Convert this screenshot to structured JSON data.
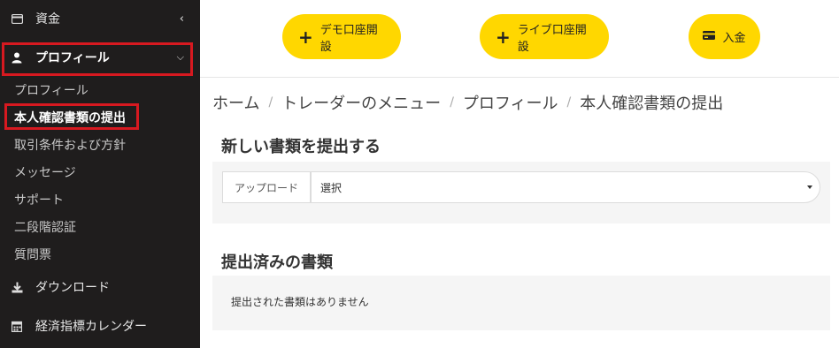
{
  "sidebar": {
    "funds_label": "資金",
    "profile_label": "プロフィール",
    "sub_items": [
      {
        "label": "プロフィール"
      },
      {
        "label": "本人確認書類の提出"
      },
      {
        "label": "取引条件および方針"
      },
      {
        "label": "メッセージ"
      },
      {
        "label": "サポート"
      },
      {
        "label": "二段階認証"
      },
      {
        "label": "質問票"
      }
    ],
    "download_label": "ダウンロード",
    "calendar_label": "経済指標カレンダー"
  },
  "toolbar": {
    "demo_label": "デモ口座開設",
    "live_label": "ライブ口座開設",
    "deposit_label": "入金"
  },
  "breadcrumb": [
    "ホーム",
    "トレーダーのメニュー",
    "プロフィール",
    "本人確認書類の提出"
  ],
  "main": {
    "new_docs_title": "新しい書類を提出する",
    "upload_label": "アップロード",
    "select_value": "選択",
    "submitted_title": "提出済みの書類",
    "empty_message": "提出された書類はありません"
  },
  "colors": {
    "accent_yellow": "#ffd700",
    "sidebar_bg": "#1f1d1d",
    "highlight_red": "#d71920"
  }
}
